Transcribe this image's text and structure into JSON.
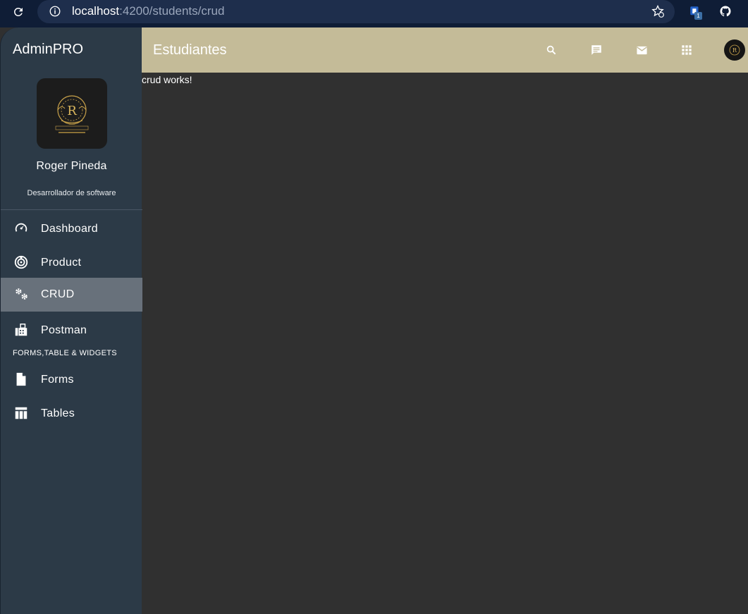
{
  "browser": {
    "url_host": "localhost",
    "url_path": ":4200/students/crud",
    "extension_badge": "1"
  },
  "sidebar": {
    "brand": "AdminPRO",
    "user_name": "Roger Pineda",
    "user_role": "Desarrollador de software",
    "items": [
      {
        "label": "Dashboard",
        "icon": "speedometer-icon"
      },
      {
        "label": "Product",
        "icon": "target-icon"
      },
      {
        "label": "CRUD",
        "icon": "gears-icon",
        "active": true
      },
      {
        "label": "Postman",
        "icon": "fax-icon"
      }
    ],
    "section_label": "FORMS,TABLE & WIDGETS",
    "section_items": [
      {
        "label": "Forms",
        "icon": "file-icon"
      },
      {
        "label": "Tables",
        "icon": "table-icon"
      }
    ]
  },
  "topbar": {
    "title": "Estudiantes",
    "icons": [
      "search-icon",
      "chat-icon",
      "mail-icon",
      "apps-grid-icon"
    ]
  },
  "main": {
    "content": "crud works!"
  },
  "colors": {
    "topbar": "#c4bb98",
    "sidebar": "#2c3a47",
    "active_item": "#68717b",
    "content_bg": "#303030"
  }
}
